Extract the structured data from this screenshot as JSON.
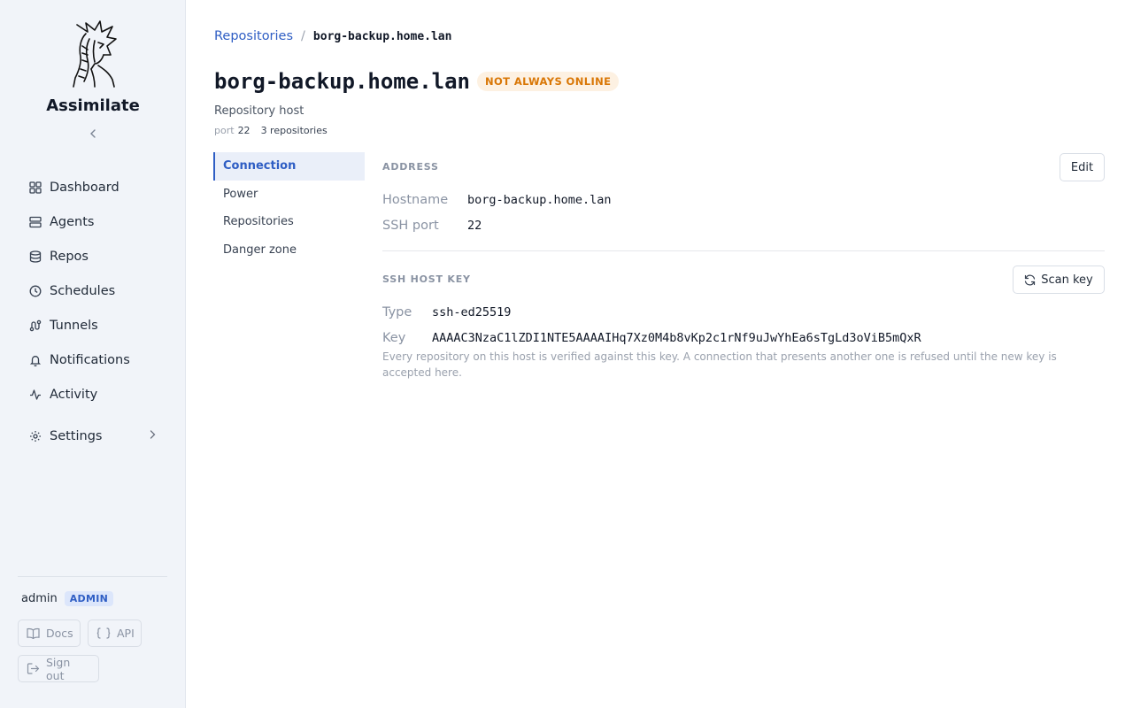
{
  "sidebar": {
    "app_name": "Assimilate",
    "collapse_icon": "chevron-left-icon",
    "nav": [
      {
        "label": "Dashboard",
        "icon": "grid-icon"
      },
      {
        "label": "Agents",
        "icon": "server-icon"
      },
      {
        "label": "Repos",
        "icon": "database-icon"
      },
      {
        "label": "Schedules",
        "icon": "clock-icon"
      },
      {
        "label": "Tunnels",
        "icon": "route-icon"
      },
      {
        "label": "Notifications",
        "icon": "bell-icon"
      },
      {
        "label": "Activity",
        "icon": "activity-icon"
      }
    ],
    "settings_label": "Settings",
    "user": {
      "name": "admin",
      "role": "ADMIN"
    },
    "docs_label": "Docs",
    "api_label": "API",
    "signout_label": "Sign out"
  },
  "breadcrumb": {
    "parent": "Repositories",
    "separator": "/",
    "current": "borg-backup.home.lan"
  },
  "header": {
    "title": "borg-backup.home.lan",
    "status": "NOT ALWAYS ONLINE",
    "subtitle": "Repository host",
    "port_key": "port",
    "port_value": "22",
    "repos_count": "3 repositories"
  },
  "section_nav": [
    {
      "label": "Connection",
      "active": true
    },
    {
      "label": "Power",
      "active": false
    },
    {
      "label": "Repositories",
      "active": false
    },
    {
      "label": "Danger zone",
      "active": false
    }
  ],
  "address": {
    "label": "ADDRESS",
    "edit_label": "Edit",
    "hostname_key": "Hostname",
    "hostname_value": "borg-backup.home.lan",
    "port_key": "SSH port",
    "port_value": "22"
  },
  "host_key": {
    "label": "SSH HOST KEY",
    "scan_label": "Scan key",
    "type_key": "Type",
    "type_value": "ssh-ed25519",
    "key_key": "Key",
    "key_value": "AAAAC3NzaC1lZDI1NTE5AAAAIHq7Xz0M4b8vKp2c1rNf9uJwYhEa6sTgLd3oViB5mQxR",
    "hint": "Every repository on this host is verified against this key. A connection that presents another one is refused until the new key is accepted here."
  },
  "colors": {
    "accent": "#2f5ec4",
    "warning": "#d97706",
    "sidebar_bg": "#f1f4f9"
  }
}
